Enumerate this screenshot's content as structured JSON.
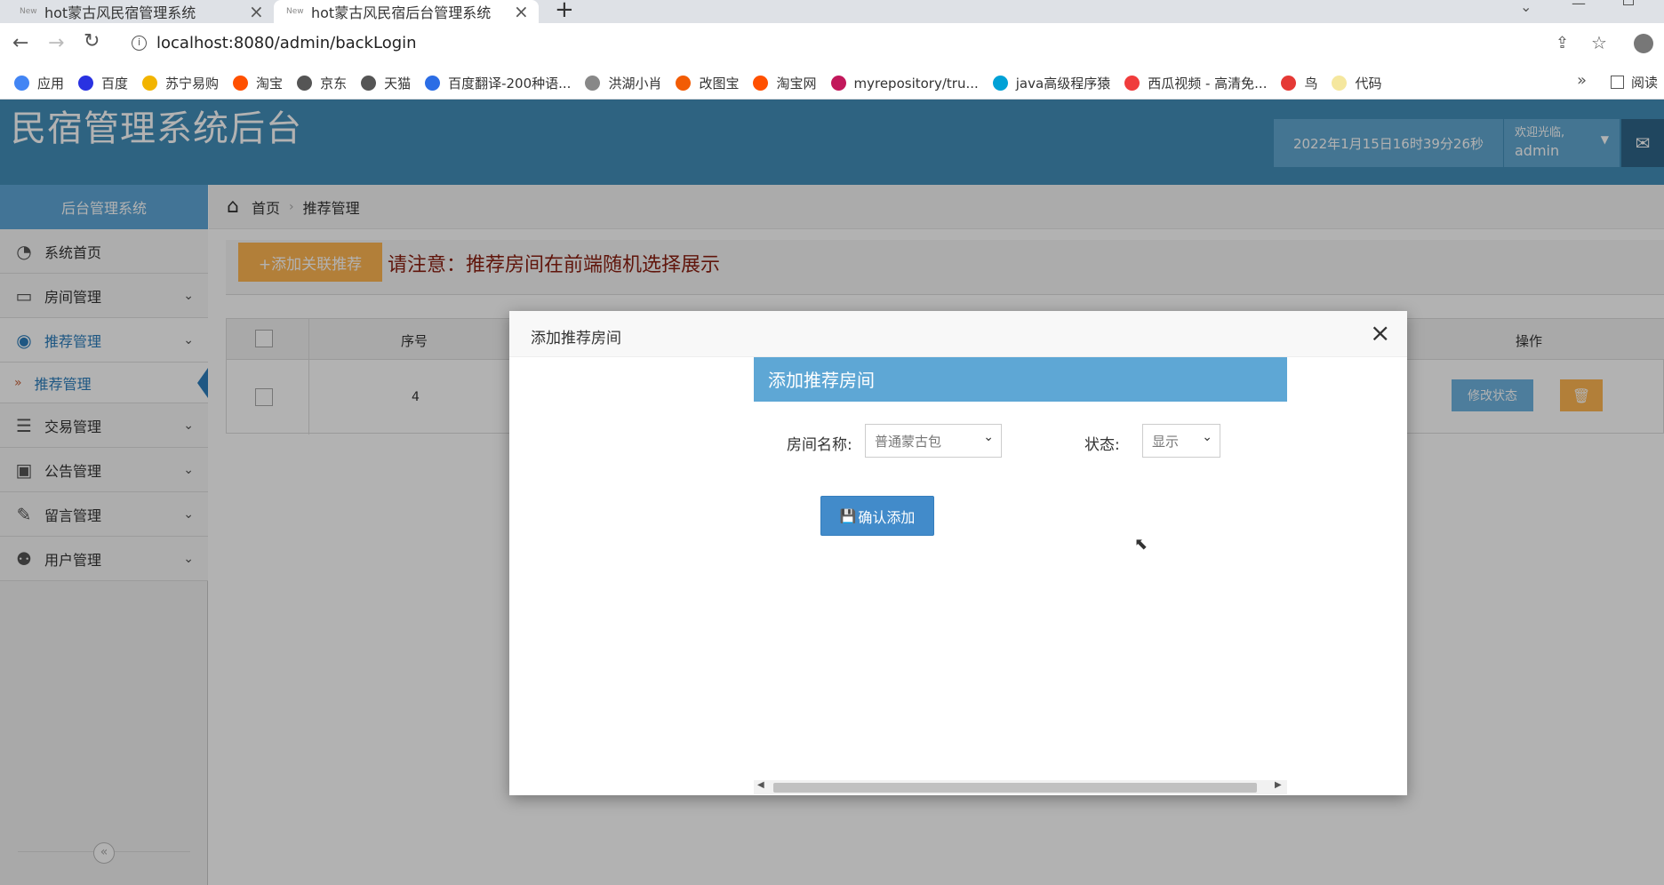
{
  "browser": {
    "tabs": [
      {
        "fav": "New",
        "title": "hot蒙古风民宿管理系统"
      },
      {
        "fav": "New",
        "title": "hot蒙古风民宿后台管理系统"
      }
    ],
    "url": "localhost:8080/admin/backLogin",
    "bookmarks": [
      {
        "label": "应用",
        "color": "#4285f4"
      },
      {
        "label": "百度",
        "color": "#2932e1"
      },
      {
        "label": "苏宁易购",
        "color": "#f2b400"
      },
      {
        "label": "淘宝",
        "color": "#ff5000"
      },
      {
        "label": "京东",
        "color": "#555555"
      },
      {
        "label": "天猫",
        "color": "#555555"
      },
      {
        "label": "百度翻译-200种语...",
        "color": "#2b6de5"
      },
      {
        "label": "洪湖小肖",
        "color": "#888888"
      },
      {
        "label": "改图宝",
        "color": "#f25c05"
      },
      {
        "label": "淘宝网",
        "color": "#ff5000"
      },
      {
        "label": "myrepository/tru...",
        "color": "#c2185b"
      },
      {
        "label": "java高级程序猿",
        "color": "#00a1d6"
      },
      {
        "label": "西瓜视频 - 高清免...",
        "color": "#f03c3c"
      },
      {
        "label": "鸟",
        "color": "#e53935"
      },
      {
        "label": "代码",
        "color": "#f5e79e"
      }
    ],
    "overflow": "»",
    "reading_list": "阅读"
  },
  "header": {
    "logo": "民宿管理系统后台",
    "datetime": "2022年1月15日16时39分26秒",
    "welcome": "欢迎光临,",
    "user": "admin"
  },
  "sidebar": {
    "title": "后台管理系统",
    "items": [
      {
        "label": "系统首页",
        "icon": "dashboard-icon"
      },
      {
        "label": "房间管理",
        "icon": "desktop-icon"
      },
      {
        "label": "推荐管理",
        "icon": "eye-icon"
      },
      {
        "label": "交易管理",
        "icon": "list-icon"
      },
      {
        "label": "公告管理",
        "icon": "picture-icon"
      },
      {
        "label": "留言管理",
        "icon": "edit-icon"
      },
      {
        "label": "用户管理",
        "icon": "users-icon"
      }
    ],
    "sub_item": "推荐管理"
  },
  "breadcrumb": {
    "home": "首页",
    "current": "推荐管理"
  },
  "toolbar": {
    "add_label": "+添加关联推荐",
    "notice": "请注意：推荐房间在前端随机选择展示"
  },
  "table": {
    "headers": {
      "index": "序号",
      "actions": "操作"
    },
    "rows": [
      {
        "index": "4",
        "status_btn": "修改状态"
      }
    ]
  },
  "modal": {
    "title": "添加推荐房间",
    "panel_title": "添加推荐房间",
    "room_label": "房间名称:",
    "room_value": "普通蒙古包",
    "status_label": "状态:",
    "status_value": "显示",
    "submit_label": "确认添加"
  },
  "colors": {
    "header": "#438eb9",
    "accent": "#5fa7d7",
    "warning": "#d99a3a",
    "button": "#428bca"
  }
}
